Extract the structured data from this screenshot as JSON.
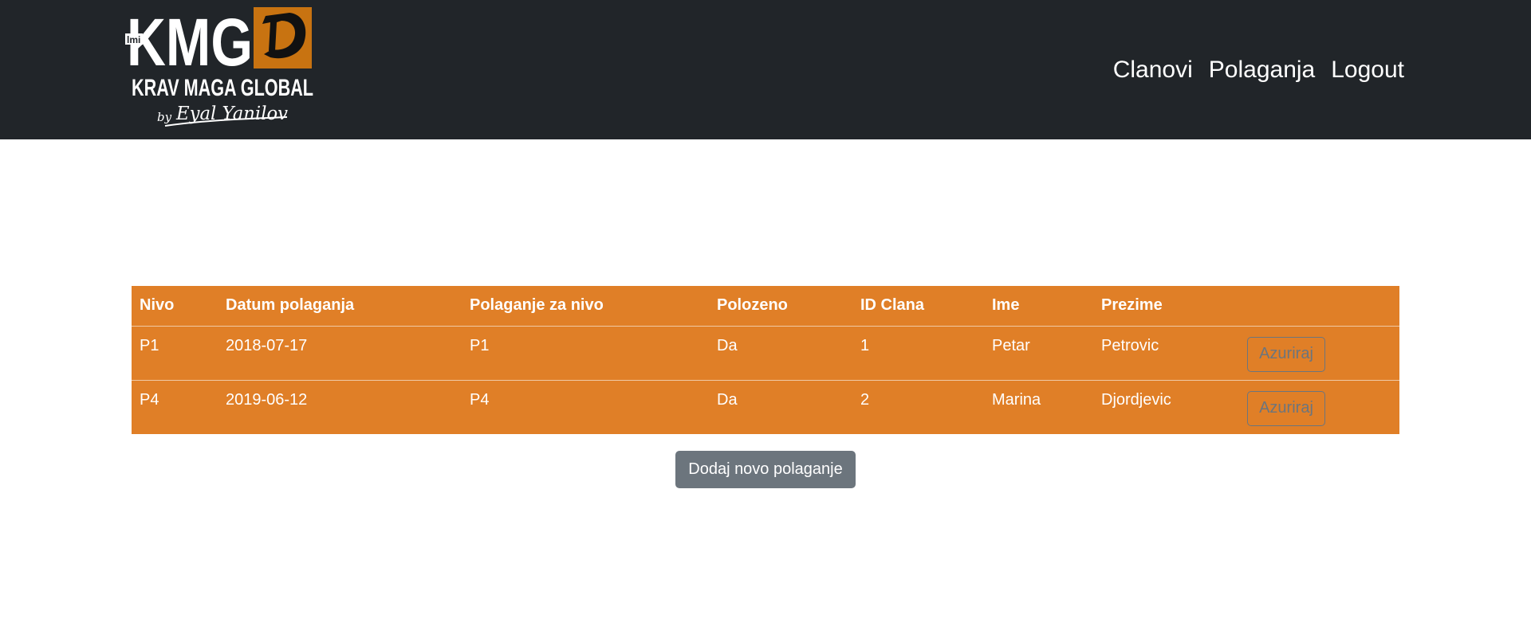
{
  "navbar": {
    "logo": {
      "abbr": "KMG",
      "badge": "lmi",
      "full_name": "KRAV MAGA GLOBAL",
      "by": "by",
      "founder": "Eyal Yanilov"
    },
    "links": [
      {
        "label": "Clanovi"
      },
      {
        "label": "Polaganja"
      },
      {
        "label": "Logout"
      }
    ]
  },
  "table": {
    "headers": [
      "Nivo",
      "Datum polaganja",
      "Polaganje za nivo",
      "Polozeno",
      "ID Clana",
      "Ime",
      "Prezime",
      ""
    ],
    "rows": [
      {
        "nivo": "P1",
        "datum": "2018-07-17",
        "za_nivo": "P1",
        "polozeno": "Da",
        "id_clana": "1",
        "ime": "Petar",
        "prezime": "Petrovic",
        "action": "Azuriraj"
      },
      {
        "nivo": "P4",
        "datum": "2019-06-12",
        "za_nivo": "P4",
        "polozeno": "Da",
        "id_clana": "2",
        "ime": "Marina",
        "prezime": "Djordjevic",
        "action": "Azuriraj"
      }
    ]
  },
  "add_button": "Dodaj novo polaganje",
  "colors": {
    "navbar_bg": "#212529",
    "table_bg": "#e07f27",
    "button_secondary": "#6c757d",
    "logo_accent": "#c87311"
  }
}
